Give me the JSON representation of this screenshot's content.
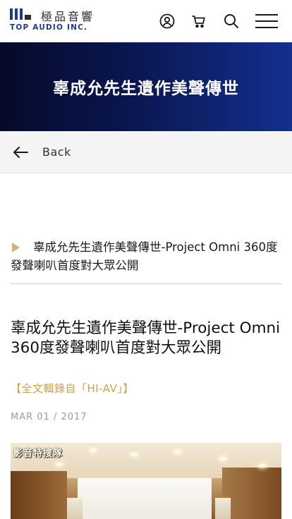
{
  "header": {
    "logo_cn": "極品音響",
    "logo_en": "TOP AUDIO INC.",
    "icons": [
      "user-icon",
      "cart-icon",
      "search-icon",
      "menu-icon"
    ]
  },
  "banner": {
    "title": "辜成允先生遺作美聲傳世"
  },
  "back": {
    "label": "Back"
  },
  "breadcrumb": {
    "text": "辜成允先生遺作美聲傳世-Project Omni 360度發聲喇叭首度對大眾公開"
  },
  "article": {
    "title": "辜成允先生遺作美聲傳世-Project Omni 360度發聲喇叭首度對大眾公開",
    "source": "【全文輯錄自「HI-AV」】",
    "date": "MAR 01 / 2017",
    "photo_tag": "影音特搜隊"
  },
  "colors": {
    "brand_blue": "#1d3a8a",
    "banner_dark": "#060a2a",
    "banner_light": "#13308e",
    "gold_accent": "#c9a24f",
    "date_gray": "#9a9a9a"
  }
}
